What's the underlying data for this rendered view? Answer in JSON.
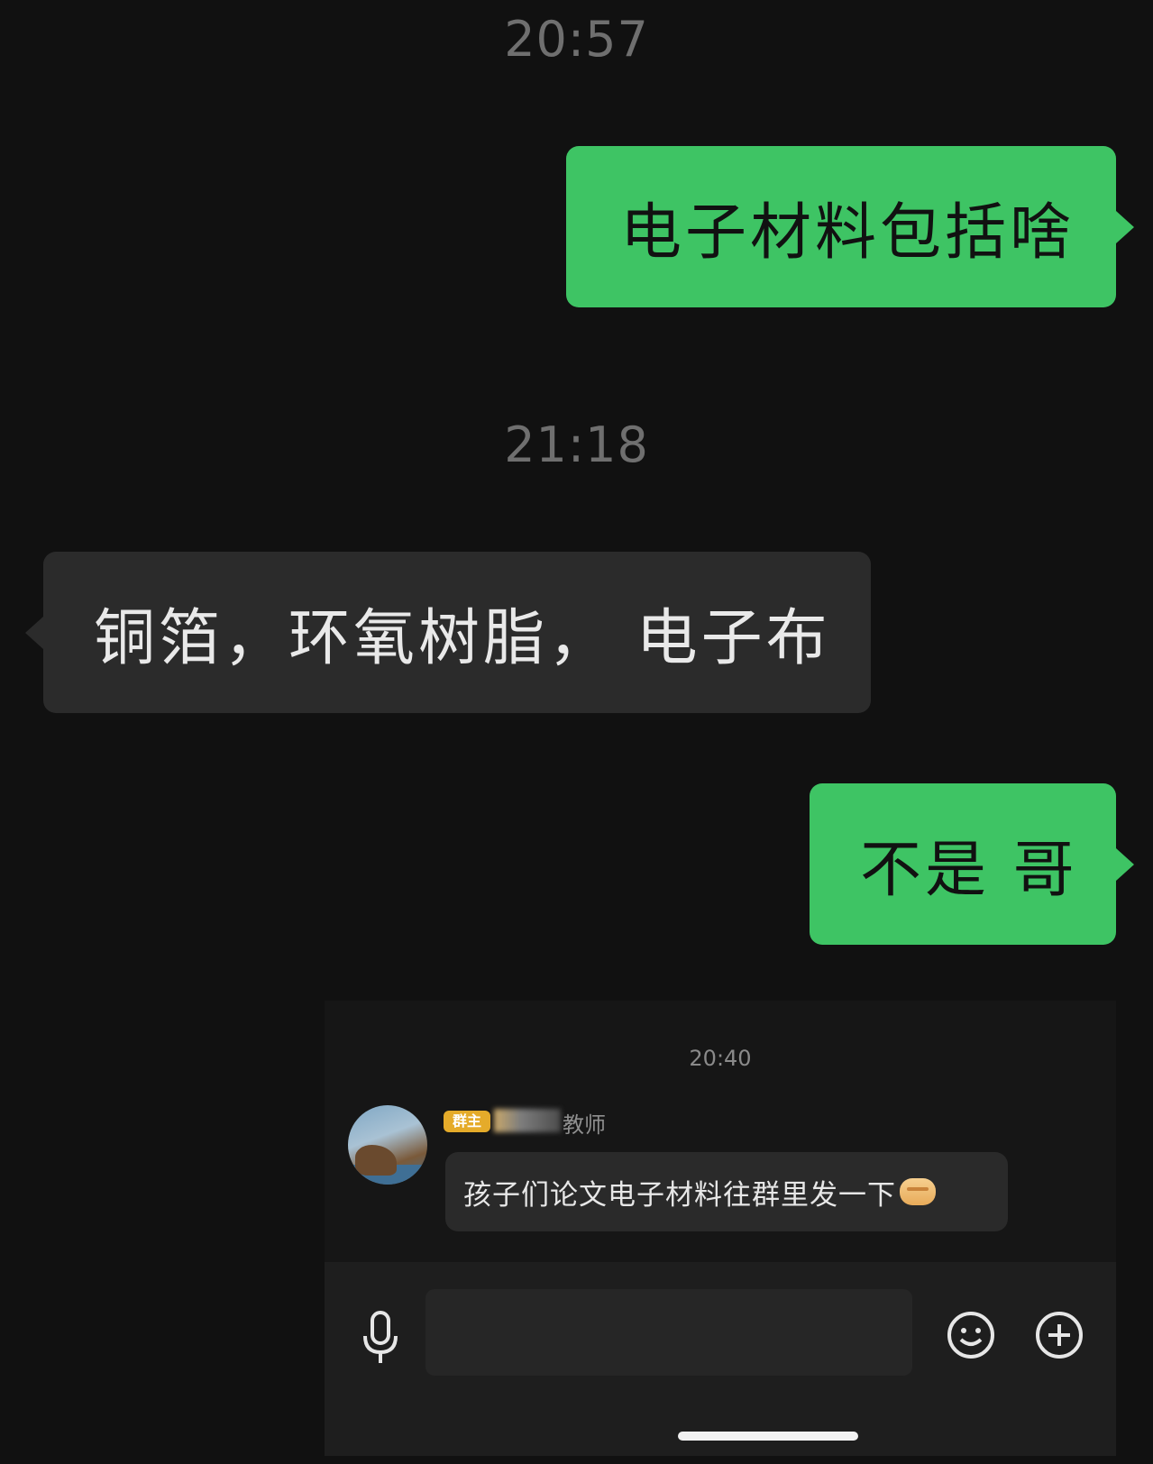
{
  "chat": {
    "timestamps": [
      "20:57",
      "21:18"
    ],
    "messages": [
      {
        "side": "sent",
        "text": "电子材料包括啥"
      },
      {
        "side": "received",
        "text": "铜箔，环氧树脂， 电子布"
      },
      {
        "side": "sent",
        "text": "不是 哥"
      }
    ]
  },
  "embedded_screenshot": {
    "timestamp": "20:40",
    "sender_badge": "群主",
    "sender_name_suffix": "教师",
    "message": "孩子们论文电子材料往群里发一下",
    "message_emoji": "handshake-icon",
    "input": {
      "value": "",
      "placeholder": ""
    },
    "icons": [
      "microphone-icon",
      "emoji-icon",
      "plus-icon"
    ]
  },
  "colors": {
    "background": "#111111",
    "sent_bubble": "#3ec464",
    "received_bubble": "#2b2b2b",
    "badge": "#e5ab2a"
  }
}
